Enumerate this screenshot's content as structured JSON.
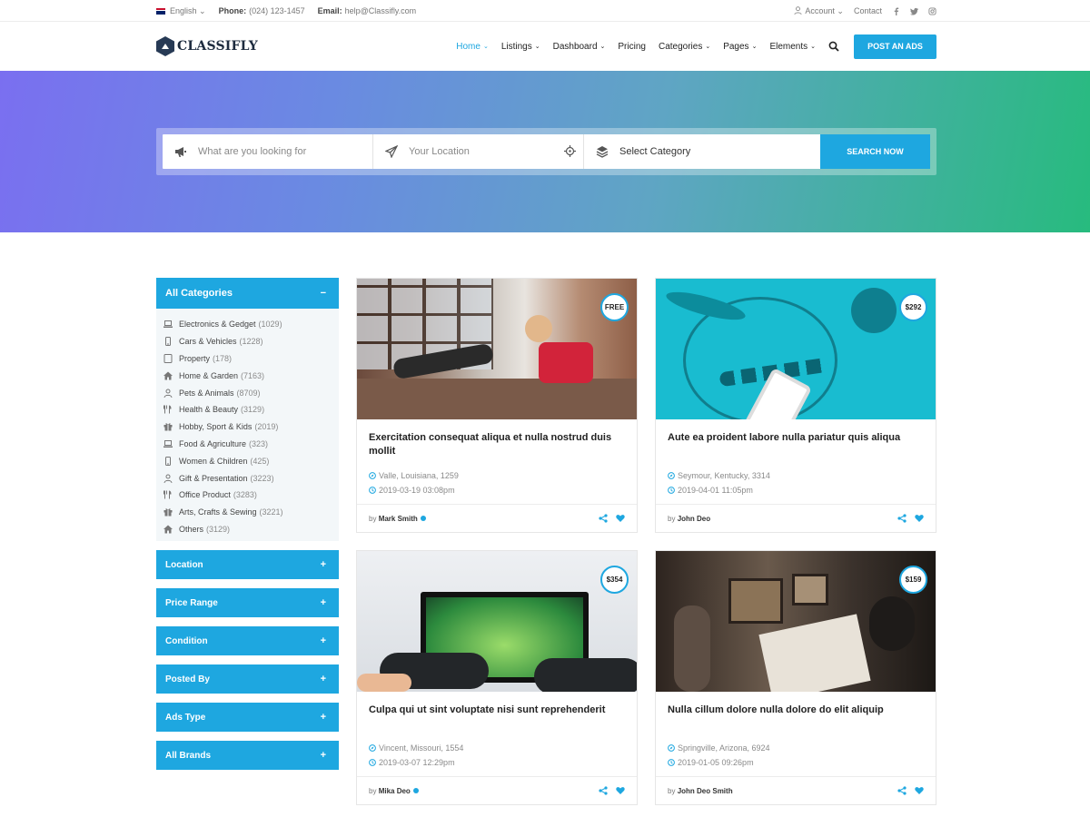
{
  "topbar": {
    "language": "English",
    "phone_label": "Phone:",
    "phone": "(024) 123-1457",
    "email_label": "Email:",
    "email": "help@Classifly.com",
    "account": "Account",
    "contact": "Contact"
  },
  "header": {
    "logo": "CLASSIFLY",
    "nav": [
      "Home",
      "Listings",
      "Dashboard",
      "Pricing",
      "Categories",
      "Pages",
      "Elements"
    ],
    "post_button": "POST AN ADS"
  },
  "search": {
    "keyword_placeholder": "What are you looking for",
    "location_placeholder": "Your Location",
    "category_label": "Select Category",
    "button": "SEARCH NOW"
  },
  "sidebar": {
    "categories_title": "All Categories",
    "collapse_sign": "−",
    "expand_sign": "+",
    "categories": [
      {
        "name": "Electronics & Gedget",
        "count": "(1029)",
        "icon": "laptop-icon"
      },
      {
        "name": "Cars & Vehicles",
        "count": "(1228)",
        "icon": "phone-icon"
      },
      {
        "name": "Property",
        "count": "(178)",
        "icon": "tablet-icon"
      },
      {
        "name": "Home & Garden",
        "count": "(7163)",
        "icon": "home-icon"
      },
      {
        "name": "Pets & Animals",
        "count": "(8709)",
        "icon": "user-icon"
      },
      {
        "name": "Health & Beauty",
        "count": "(3129)",
        "icon": "utensils-icon"
      },
      {
        "name": "Hobby, Sport & Kids",
        "count": "(2019)",
        "icon": "gift-icon"
      },
      {
        "name": "Food & Agriculture",
        "count": "(323)",
        "icon": "laptop-icon"
      },
      {
        "name": "Women & Children",
        "count": "(425)",
        "icon": "phone-icon"
      },
      {
        "name": "Gift & Presentation",
        "count": "(3223)",
        "icon": "user-icon"
      },
      {
        "name": "Office Product",
        "count": "(3283)",
        "icon": "utensils-icon"
      },
      {
        "name": "Arts, Crafts & Sewing",
        "count": "(3221)",
        "icon": "gift-icon"
      },
      {
        "name": "Others",
        "count": "(3129)",
        "icon": "home-icon"
      }
    ],
    "filters": [
      "Location",
      "Price Range",
      "Condition",
      "Posted By",
      "Ads Type",
      "All Brands"
    ]
  },
  "listings": [
    {
      "price": "FREE",
      "title": "Exercitation consequat aliqua et nulla nostrud duis mollit",
      "location": "Valle, Louisiana, 1259",
      "date": "2019-03-19 03:08pm",
      "by": "by",
      "author": "Mark Smith",
      "verified": true
    },
    {
      "price": "$292",
      "title": "Aute ea proident labore nulla pariatur quis aliqua",
      "location": "Seymour, Kentucky, 3314",
      "date": "2019-04-01 11:05pm",
      "by": "by",
      "author": "John Deo",
      "verified": false
    },
    {
      "price": "$354",
      "title": "Culpa qui ut sint voluptate nisi sunt reprehenderit",
      "location": "Vincent, Missouri, 1554",
      "date": "2019-03-07 12:29pm",
      "by": "by",
      "author": "Mika Deo",
      "verified": true
    },
    {
      "price": "$159",
      "title": "Nulla cillum dolore nulla dolore do elit aliquip",
      "location": "Springville, Arizona, 6924",
      "date": "2019-01-05 09:26pm",
      "by": "by",
      "author": "John Deo Smith",
      "verified": false
    }
  ],
  "colors": {
    "accent": "#1ea7e0",
    "hero_start": "#7a6ff0",
    "hero_end": "#27bb7e"
  }
}
